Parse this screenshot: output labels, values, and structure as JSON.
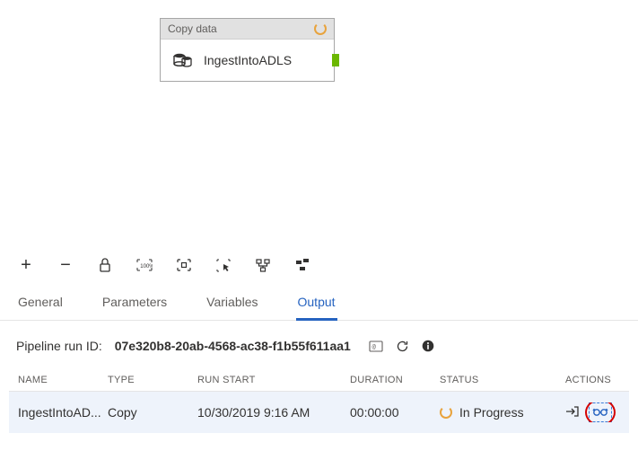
{
  "canvas": {
    "activity": {
      "header_label": "Copy data",
      "name": "IngestIntoADLS"
    }
  },
  "tabs": {
    "general": "General",
    "parameters": "Parameters",
    "variables": "Variables",
    "output": "Output",
    "active": "output"
  },
  "runbar": {
    "label": "Pipeline run ID:",
    "id": "07e320b8-20ab-4568-ac38-f1b55f611aa1"
  },
  "table": {
    "headers": {
      "name": "NAME",
      "type": "TYPE",
      "run_start": "RUN START",
      "duration": "DURATION",
      "status": "STATUS",
      "actions": "ACTIONS"
    },
    "rows": [
      {
        "name": "IngestIntoAD...",
        "type": "Copy",
        "run_start": "10/30/2019 9:16 AM",
        "duration": "00:00:00",
        "status": "In Progress"
      }
    ]
  }
}
